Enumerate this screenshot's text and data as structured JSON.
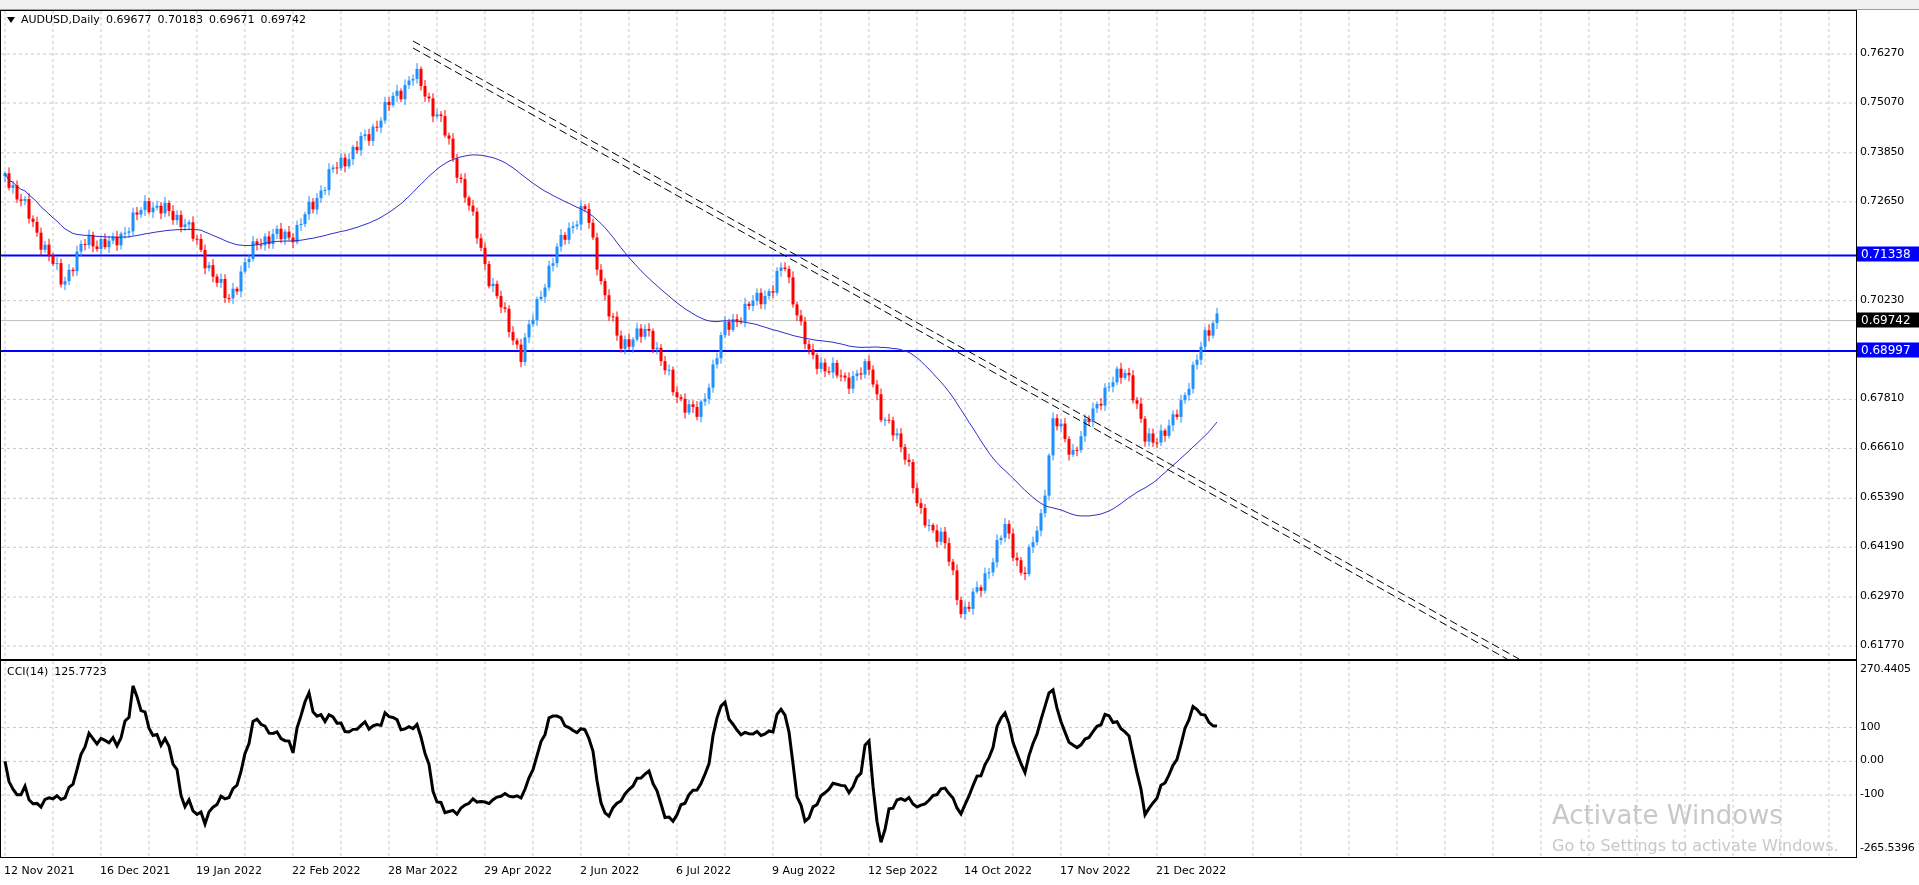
{
  "header": {
    "symbol": "AUDUSD,Daily",
    "quotes": [
      "0.69677",
      "0.70183",
      "0.69671",
      "0.69742"
    ]
  },
  "price_axis": [
    "0.76270",
    "0.75070",
    "0.73850",
    "0.72650",
    "0.70230",
    "0.67810",
    "0.66610",
    "0.65390",
    "0.64190",
    "0.62970",
    "0.61770"
  ],
  "price_markers": [
    {
      "label": "0.71338",
      "kind": "line"
    },
    {
      "label": "0.69742",
      "kind": "bid"
    },
    {
      "label": "0.68997",
      "kind": "line"
    }
  ],
  "indicator": {
    "name": "CCI(14)",
    "value": "125.7723",
    "axis": [
      "270.4405",
      "100",
      "0.00",
      "-100",
      "-265.5396"
    ]
  },
  "date_axis": [
    "12 Nov 2021",
    "16 Dec 2021",
    "19 Jan 2022",
    "22 Feb 2022",
    "28 Mar 2022",
    "29 Apr 2022",
    "2 Jun 2022",
    "6 Jul 2022",
    "9 Aug 2022",
    "12 Sep 2022",
    "14 Oct 2022",
    "17 Nov 2022",
    "21 Dec 2022"
  ],
  "os_notice": {
    "title": "Activate Windows",
    "subtitle": "Go to Settings to activate Windows."
  }
}
